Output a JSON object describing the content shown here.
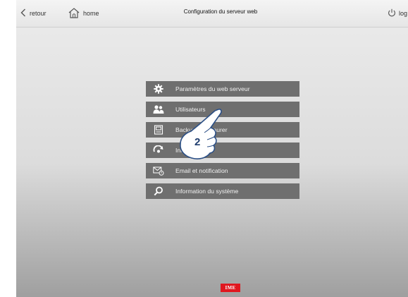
{
  "header": {
    "back_label": "retour",
    "home_label": "home",
    "title": "Configuration du serveur web",
    "logout_label": "log"
  },
  "menu": {
    "items": [
      {
        "label": "Paramètres du web serveur",
        "icon": "gear-icon"
      },
      {
        "label": "Utilisateurs",
        "icon": "users-icon"
      },
      {
        "label": "Backup / Restaurer",
        "icon": "backup-icon"
      },
      {
        "label": "Initialiser",
        "icon": "reset-icon"
      },
      {
        "label": "Email et notification",
        "icon": "email-icon"
      },
      {
        "label": "Information du système",
        "icon": "search-icon"
      }
    ]
  },
  "annotation": {
    "step_number": "2"
  },
  "brand": {
    "logo_text": "IME",
    "color": "#e0171f"
  },
  "colors": {
    "menu_item_bg": "#6f6f6f",
    "menu_item_text": "#f1f1f1"
  }
}
